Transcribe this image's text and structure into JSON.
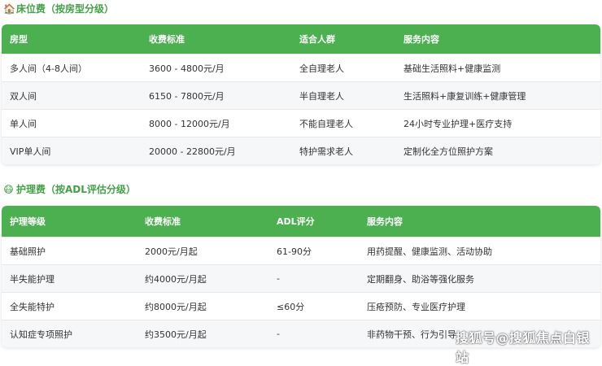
{
  "section1": {
    "icon": "house-icon",
    "title": "床位费（按房型分级）",
    "headers": [
      "房型",
      "收费标准",
      "适合人群",
      "服务内容"
    ],
    "rows": [
      [
        "多人间（4-8人间）",
        "3600 - 4800元/月",
        "全自理老人",
        "基础生活照料+健康监测"
      ],
      [
        "双人间",
        "6150 - 7800元/月",
        "半自理老人",
        "生活照料+康复训练+健康管理"
      ],
      [
        "单人间",
        "8000 - 12000元/月",
        "不能自理老人",
        "24小时专业护理+医疗支持"
      ],
      [
        "VIP单人间",
        "20000 - 22800元/月",
        "特护需求老人",
        "定制化全方位照护方案"
      ]
    ]
  },
  "section2": {
    "icon": "nurse-face-icon",
    "title": "护理费（按ADL评估分级）",
    "headers": [
      "护理等级",
      "收费标准",
      "ADL评分",
      "服务内容"
    ],
    "rows": [
      [
        "基础照护",
        "2000元/月起",
        "61-90分",
        "用药提醒、健康监测、活动协助"
      ],
      [
        "半失能护理",
        "约4000元/月起",
        "-",
        "定期翻身、助浴等强化服务"
      ],
      [
        "全失能特护",
        "约8000元/月起",
        "≤60分",
        "压疮预防、专业医疗护理"
      ],
      [
        "认知症专项照护",
        "约3500元/月起",
        "-",
        "非药物干预、行为引导"
      ]
    ]
  },
  "watermark": "搜狐号@搜狐焦点白银站",
  "colors": {
    "accent": "#4caf50",
    "title": "#43a047"
  }
}
